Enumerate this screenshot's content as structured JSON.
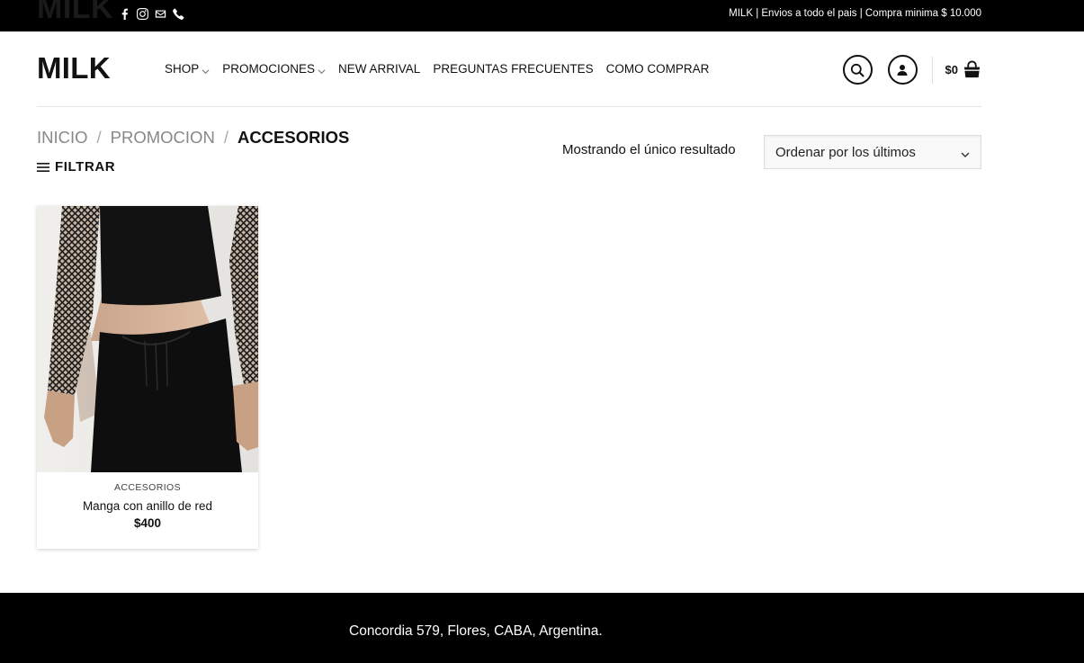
{
  "topbar": {
    "logo_text": "MILK",
    "announcement": "MILK | Envios a todo el pais | Compra minima $ 10.000",
    "social_icons": [
      "facebook-icon",
      "instagram-icon",
      "email-icon",
      "phone-icon"
    ]
  },
  "header": {
    "logo": "MILK",
    "nav": [
      {
        "label": "SHOP",
        "has_dropdown": true
      },
      {
        "label": "PROMOCIONES",
        "has_dropdown": true
      },
      {
        "label": "NEW ARRIVAL",
        "has_dropdown": false
      },
      {
        "label": "PREGUNTAS FRECUENTES",
        "has_dropdown": false
      },
      {
        "label": "COMO COMPRAR",
        "has_dropdown": false
      }
    ],
    "cart_total": "$0",
    "icons": [
      "search-icon",
      "account-icon",
      "cart-icon"
    ]
  },
  "breadcrumb": {
    "items": [
      "INICIO",
      "PROMOCION"
    ],
    "separator": "/",
    "current": "ACCESORIOS"
  },
  "filter_label": "FILTRAR",
  "result_count": "Mostrando el único resultado",
  "sort": {
    "selected": "Ordenar por los últimos"
  },
  "products": [
    {
      "category": "ACCESORIOS",
      "name": "Manga con anillo de red",
      "price": "$400"
    }
  ],
  "footer": {
    "address": "Concordia 579, Flores, CABA, Argentina."
  },
  "colors": {
    "topbar_bg": "#000000",
    "footer_bg": "#000000",
    "breadcrumb_muted": "#888888",
    "text": "#111111"
  }
}
